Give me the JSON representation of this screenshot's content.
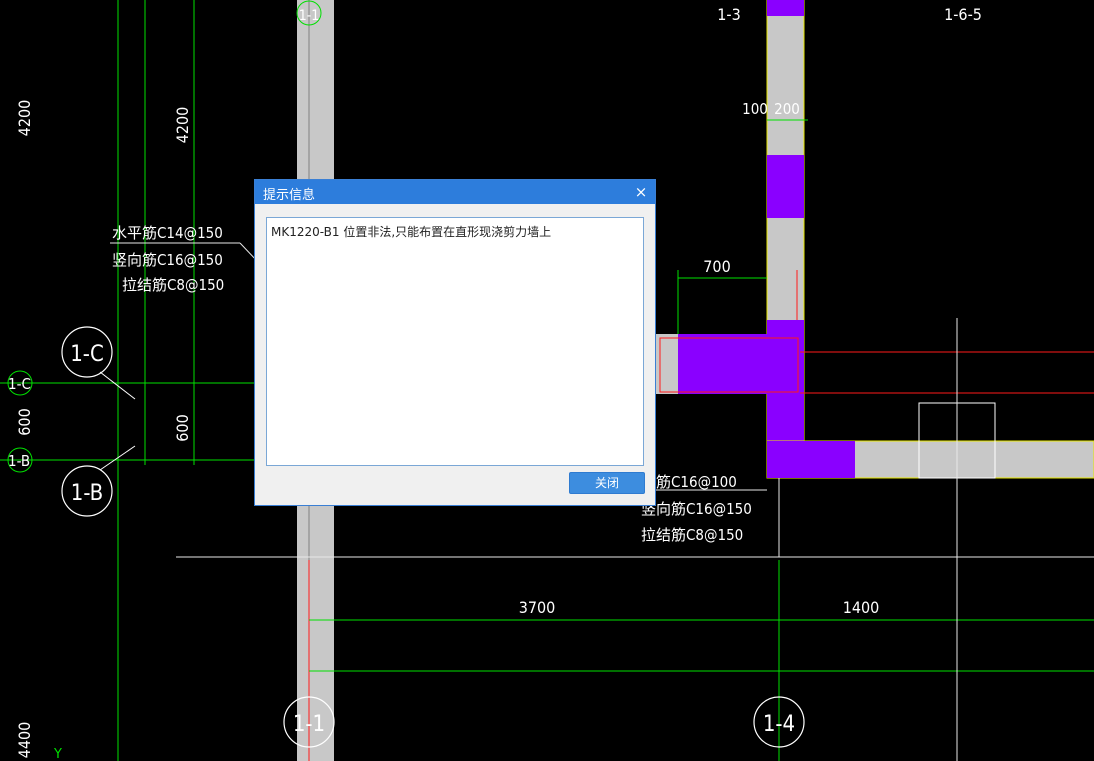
{
  "cad": {
    "dims": {
      "left_top": "4200",
      "inner_top": "4200",
      "left_mid": "600",
      "inner_mid": "600",
      "left_bottom": "4400",
      "right_top_a": "100",
      "right_top_b": "200",
      "right_700": "700",
      "bottom_3700": "3700",
      "bottom_1400": "1400"
    },
    "axes": {
      "c_bubble": "1-C",
      "b_bubble": "1-B",
      "c_edge": "1-C",
      "b_edge": "1-B",
      "top_1": "1-1",
      "top_3": "1-3",
      "top_5": "1-6-5",
      "bottom_1": "1-1",
      "bottom_4": "1-4",
      "y_axis": "Y"
    },
    "rebar_left": {
      "line1": "水平筋C14@150",
      "line2": "竖向筋C16@150",
      "line3": "拉结筋C8@150"
    },
    "rebar_right": {
      "line1": "筋C16@100",
      "line2": "竖向筋C16@150",
      "line3": "拉结筋C8@150"
    },
    "colors": {
      "background": "#000000",
      "grid": "#00e000",
      "wall": "#c8c8c8",
      "highlight_wall": "#8a00ff",
      "marker": "#ff1a1a"
    }
  },
  "dialog": {
    "title": "提示信息",
    "close_glyph": "×",
    "message": "MK1220-B1 位置非法,只能布置在直形现浇剪力墙上",
    "button_label": "关闭"
  }
}
